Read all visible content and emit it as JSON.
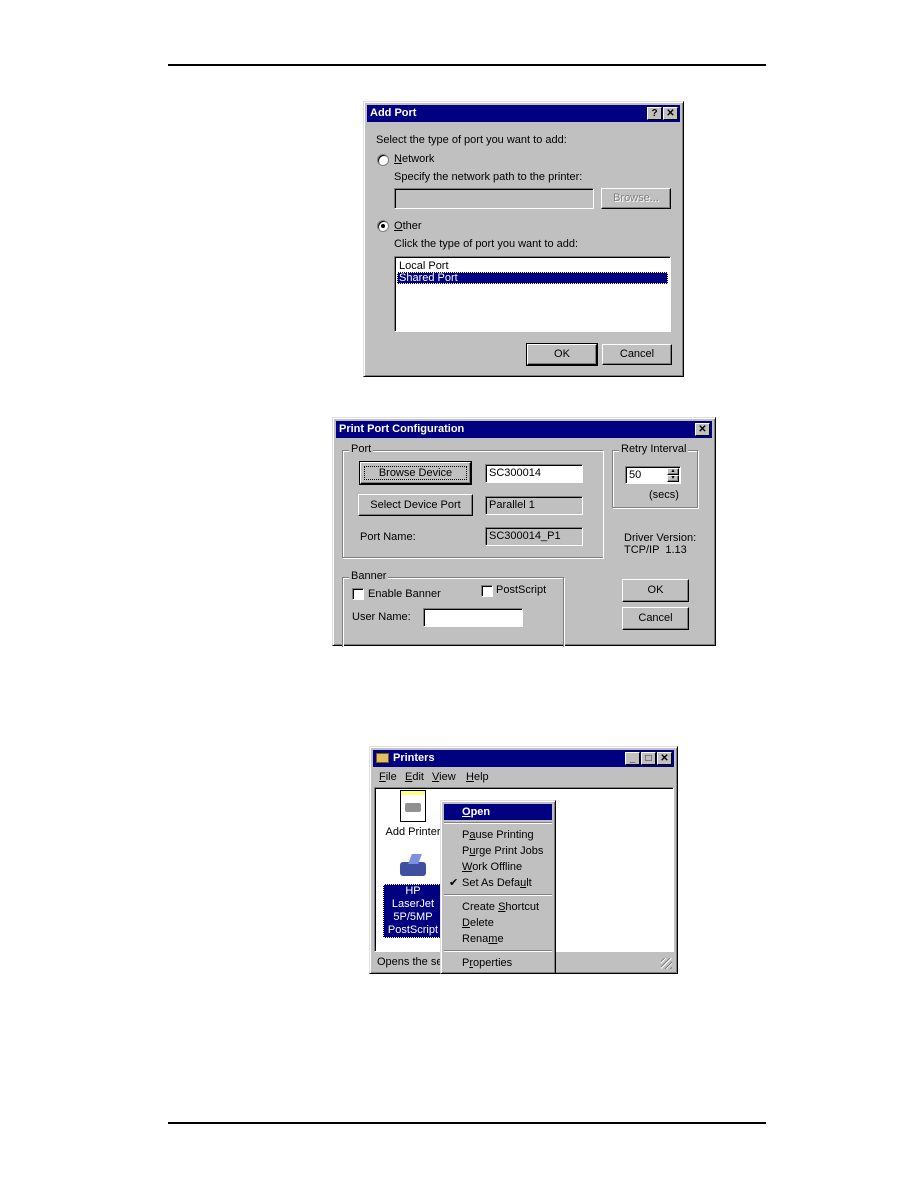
{
  "add_port": {
    "title": "Add Port",
    "help_label": "?",
    "close_label": "✕",
    "prompt": "Select the type of port you want to add:",
    "network_label": "Network",
    "network_hint": "Specify the network path to the printer:",
    "network_path_value": "",
    "browse_label": "Browse...",
    "other_label": "Other",
    "other_hint": "Click the type of port you want to add:",
    "port_types": [
      "Local Port",
      "Shared Port"
    ],
    "selected_port_type": "Shared Port",
    "selected_option": "Other",
    "ok_label": "OK",
    "cancel_label": "Cancel"
  },
  "print_port_config": {
    "title": "Print Port Configuration",
    "close_label": "✕",
    "port_group_label": "Port",
    "browse_device_label": "Browse Device",
    "device_name_value": "SC300014",
    "select_device_port_label": "Select Device Port",
    "device_port_value": "Parallel 1",
    "port_name_label": "Port Name:",
    "port_name_value": "SC300014_P1",
    "retry_group_label": "Retry Interval",
    "retry_value": "50",
    "retry_unit": "(secs)",
    "driver_version_label": "Driver Version:",
    "driver_version_value": "TCP/IP  1.13",
    "banner_group_label": "Banner",
    "enable_banner_label": "Enable Banner",
    "enable_banner_checked": false,
    "postscript_label": "PostScript",
    "postscript_checked": false,
    "user_name_label": "User Name:",
    "user_name_value": "",
    "ok_label": "OK",
    "cancel_label": "Cancel"
  },
  "printers_window": {
    "title": "Printers",
    "menu": [
      "File",
      "Edit",
      "View",
      "Help"
    ],
    "items": [
      {
        "label": "Add Printer",
        "icon": "add-printer-icon"
      },
      {
        "label": "HP LaserJet 5P/5MP PostScript",
        "lines": [
          "HP LaserJet",
          "5P/5MP",
          "PostScript"
        ],
        "icon": "printer-icon",
        "selected": true
      }
    ],
    "status_text": "Opens the selected items.",
    "status_visible": "Opens the sel",
    "context_menu": {
      "items": [
        {
          "label": "Open",
          "default": true,
          "highlighted": true
        },
        {
          "separator": true
        },
        {
          "label": "Pause Printing"
        },
        {
          "label": "Purge Print Jobs"
        },
        {
          "label": "Work Offline"
        },
        {
          "label": "Set As Default",
          "checked": true
        },
        {
          "separator": true
        },
        {
          "label": "Create Shortcut"
        },
        {
          "label": "Delete"
        },
        {
          "label": "Rename"
        },
        {
          "separator": true
        },
        {
          "label": "Properties"
        }
      ]
    }
  }
}
